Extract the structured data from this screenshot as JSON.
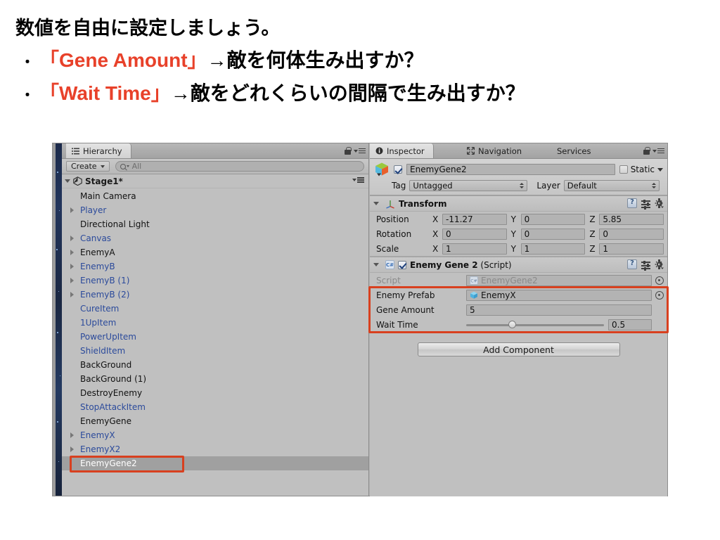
{
  "slide": {
    "headline": "数値を自由に設定しましょう。",
    "bullets": [
      {
        "marker": "・",
        "highlight": "「Gene Amount」",
        "rest": " →敵を何体生み出すか？"
      },
      {
        "marker": "・",
        "highlight": "「Wait Time」",
        "rest": " →敵をどれくらいの間隔で生み出すか？"
      }
    ],
    "highlight_color": "#e8412a",
    "text_color": "#000000"
  },
  "hierarchy": {
    "tabs": [
      {
        "label": "Hierarchy",
        "icon": "hierarchy-list-icon",
        "active": true
      }
    ],
    "lock_icon": "lock-icon",
    "menu_icon": "panel-menu-icon",
    "toolbar": {
      "create_label": "Create",
      "create_caret": "chevron-down-icon",
      "search_icon": "search-icon",
      "search_placeholder": "All",
      "search_value": ""
    },
    "scene": {
      "name": "Stage1*",
      "expanded": true,
      "icon": "unity-logo-icon"
    },
    "nodes": [
      {
        "label": "Main Camera",
        "prefab": false,
        "expandable": false,
        "selected": false
      },
      {
        "label": "Player",
        "prefab": true,
        "expandable": true,
        "selected": false
      },
      {
        "label": "Directional Light",
        "prefab": false,
        "expandable": false,
        "selected": false
      },
      {
        "label": "Canvas",
        "prefab": true,
        "expandable": true,
        "selected": false
      },
      {
        "label": "EnemyA",
        "prefab": false,
        "expandable": true,
        "selected": false
      },
      {
        "label": "EnemyB",
        "prefab": true,
        "expandable": true,
        "selected": false
      },
      {
        "label": "EnemyB (1)",
        "prefab": true,
        "expandable": true,
        "selected": false
      },
      {
        "label": "EnemyB (2)",
        "prefab": true,
        "expandable": true,
        "selected": false
      },
      {
        "label": "CureItem",
        "prefab": true,
        "expandable": false,
        "selected": false
      },
      {
        "label": "1UpItem",
        "prefab": true,
        "expandable": false,
        "selected": false
      },
      {
        "label": "PowerUpItem",
        "prefab": true,
        "expandable": false,
        "selected": false
      },
      {
        "label": "ShieldItem",
        "prefab": true,
        "expandable": false,
        "selected": false
      },
      {
        "label": "BackGround",
        "prefab": false,
        "expandable": false,
        "selected": false
      },
      {
        "label": "BackGround (1)",
        "prefab": false,
        "expandable": false,
        "selected": false
      },
      {
        "label": "DestroyEnemy",
        "prefab": false,
        "expandable": false,
        "selected": false
      },
      {
        "label": "StopAttackItem",
        "prefab": true,
        "expandable": false,
        "selected": false
      },
      {
        "label": "EnemyGene",
        "prefab": false,
        "expandable": false,
        "selected": false
      },
      {
        "label": "EnemyX",
        "prefab": true,
        "expandable": true,
        "selected": false
      },
      {
        "label": "EnemyX2",
        "prefab": true,
        "expandable": true,
        "selected": false
      },
      {
        "label": "EnemyGene2",
        "prefab": false,
        "expandable": false,
        "selected": true
      }
    ]
  },
  "inspector": {
    "tabs": [
      {
        "label": "Inspector",
        "icon": "info-icon",
        "active": true
      },
      {
        "label": "Navigation",
        "icon": "navigation-icon",
        "active": false
      },
      {
        "label": "Services",
        "icon": "",
        "active": false
      }
    ],
    "lock_icon": "lock-icon",
    "menu_icon": "panel-menu-icon",
    "gameobject": {
      "icon": "gameobject-cube-icon",
      "enabled": true,
      "name": "EnemyGene2",
      "static_label": "Static",
      "static_checked": false,
      "tag_label": "Tag",
      "tag_value": "Untagged",
      "layer_label": "Layer",
      "layer_value": "Default"
    },
    "components": [
      {
        "title": "Transform",
        "title_suffix": "",
        "icon": "transform-axis-icon",
        "expanded": true,
        "has_checkbox": false,
        "header_icons": [
          "help-book-icon",
          "preset-icon",
          "gear-icon"
        ],
        "rows": [
          {
            "type": "vector3",
            "label": "Position",
            "x": "-11.27",
            "y": "0",
            "z": "5.85"
          },
          {
            "type": "vector3",
            "label": "Rotation",
            "x": "0",
            "y": "0",
            "z": "0"
          },
          {
            "type": "vector3",
            "label": "Scale",
            "x": "1",
            "y": "1",
            "z": "1"
          }
        ]
      },
      {
        "title": "Enemy Gene 2",
        "title_suffix": " (Script)",
        "icon": "csharp-script-icon",
        "expanded": true,
        "has_checkbox": true,
        "checked": true,
        "header_icons": [
          "help-book-icon",
          "preset-icon",
          "gear-icon"
        ],
        "rows": [
          {
            "type": "object",
            "label": "Script",
            "value": "EnemyGene2",
            "value_icon": "csharp-script-icon",
            "dim": true,
            "picker": true
          },
          {
            "type": "object",
            "label": "Enemy Prefab",
            "value": "EnemyX",
            "value_icon": "prefab-cube-icon",
            "dim": false,
            "picker": true
          },
          {
            "type": "text",
            "label": "Gene Amount",
            "value": "5"
          },
          {
            "type": "slider",
            "label": "Wait Time",
            "value": "0.5",
            "knob_percent": 33
          }
        ]
      }
    ],
    "add_component_label": "Add Component"
  },
  "annotations": {
    "box_color": "#d8401f",
    "boxes": [
      "hierarchy-selected-row-box",
      "script-fields-box"
    ]
  }
}
